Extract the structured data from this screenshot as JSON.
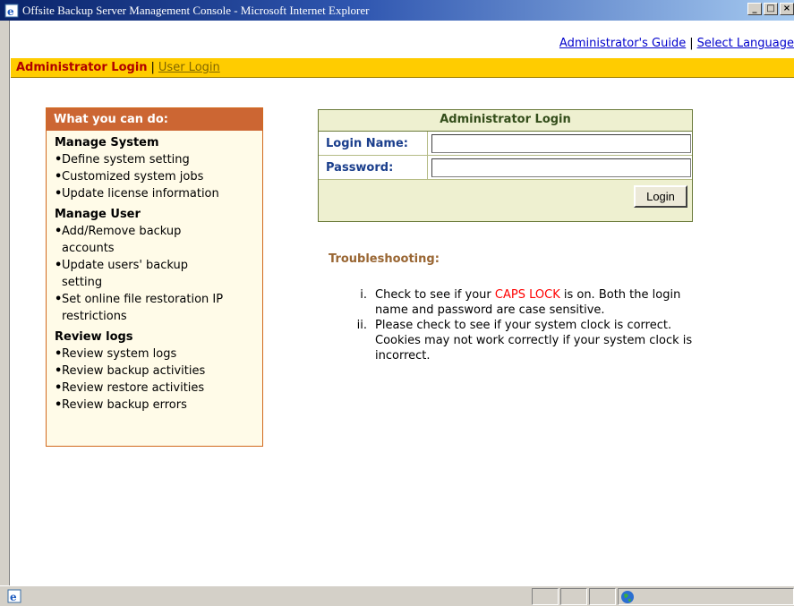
{
  "window": {
    "title": "Offsite Backup Server Management Console - Microsoft Internet Explorer",
    "buttons": [
      "_",
      "□",
      "×"
    ]
  },
  "toplinks": {
    "admin_guide": "Administrator's Guide",
    "separator": "|",
    "select_language": "Select Language"
  },
  "nav": {
    "active": "Administrator Login",
    "separator": "|",
    "user_login": "User Login"
  },
  "whatbox": {
    "title": "What you can do:",
    "sections": [
      {
        "title": "Manage System",
        "items": [
          "Define system setting",
          "Customized system jobs",
          "Update license information"
        ]
      },
      {
        "title": "Manage User",
        "items": [
          "Add/Remove backup accounts",
          "Update users' backup setting",
          "Set online file restoration IP restrictions"
        ]
      },
      {
        "title": "Review logs",
        "items": [
          "Review system logs",
          "Review backup activities",
          "Review restore activities",
          "Review backup errors"
        ]
      }
    ]
  },
  "login": {
    "title": "Administrator Login",
    "login_name_label": "Login Name:",
    "login_name_value": "",
    "password_label": "Password:",
    "password_value": "",
    "button": "Login"
  },
  "troubleshooting": {
    "title": "Troubleshooting:",
    "item1_num": "i.",
    "item1_pre": "Check to see if your ",
    "item1_caps": "CAPS LOCK",
    "item1_post": " is on. Both the login name and password are case sensitive.",
    "item2_num": "ii.",
    "item2": "Please check to see if your system clock is correct. Cookies may not work correctly if your system clock is incorrect."
  },
  "icons": {
    "window": "ie-icon",
    "status": "ie-page-icon",
    "zone": "globe-icon"
  },
  "colors": {
    "navbar": "#ffcc00",
    "whatbox_head": "#cc6633",
    "login_panel": "#eef0d0",
    "caps_lock": "#ff0000",
    "link": "#0000cc"
  }
}
